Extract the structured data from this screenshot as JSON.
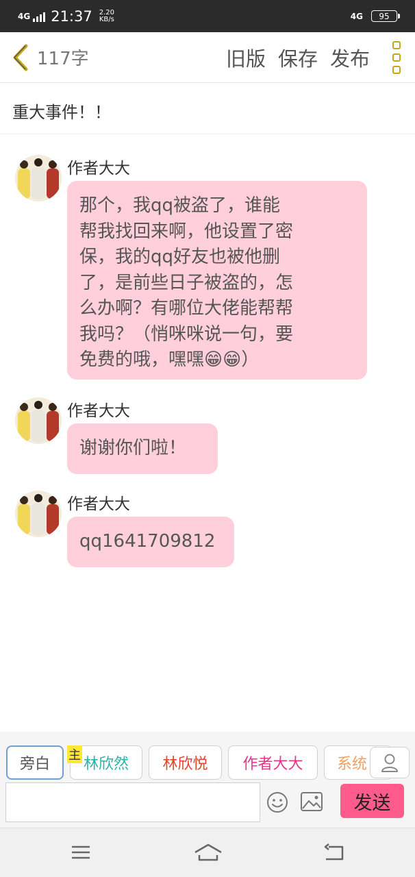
{
  "status_bar": {
    "network": "4G",
    "time": "21:37",
    "speed_value": "2.20",
    "speed_unit": "KB/s",
    "network_right": "4G",
    "battery": "95"
  },
  "toolbar": {
    "word_count": "117字",
    "old_version": "旧版",
    "save": "保存",
    "publish": "发布",
    "accent_color": "#c4a81a"
  },
  "story": {
    "title": "重大事件！！"
  },
  "messages": [
    {
      "author": "作者大大",
      "lines": [
        "那个，我qq被盗了，谁能",
        "帮我找回来啊，他设置了密",
        "保，我的qq好友也被他删",
        "了，是前些日子被盗的，怎",
        "么办啊？有哪位大佬能帮帮",
        "我吗？（悄咪咪说一句，要",
        "免费的哦，嘿嘿😁😁）"
      ]
    },
    {
      "author": "作者大大",
      "lines": [
        "谢谢你们啦！"
      ]
    },
    {
      "author": "作者大大",
      "lines": [
        "qq1641709812"
      ]
    }
  ],
  "roles": [
    {
      "label": "旁白",
      "color": "#555555"
    },
    {
      "label": "林欣然",
      "color": "#2bb3a8"
    },
    {
      "label": "林欣悦",
      "color": "#e0452b"
    },
    {
      "label": "作者大大",
      "color": "#e6358a"
    },
    {
      "label": "系统",
      "color": "#f0a060"
    }
  ],
  "host_tag": "主",
  "composer": {
    "input_value": "",
    "send_label": "发送",
    "send_color": "#ff5c8d"
  },
  "icons": {
    "back": "chevron-left-icon",
    "more": "more-vertical-icon",
    "user": "user-icon",
    "emoji": "emoji-icon",
    "image": "image-icon",
    "menu": "menu-icon",
    "home": "home-icon",
    "return": "return-icon"
  }
}
